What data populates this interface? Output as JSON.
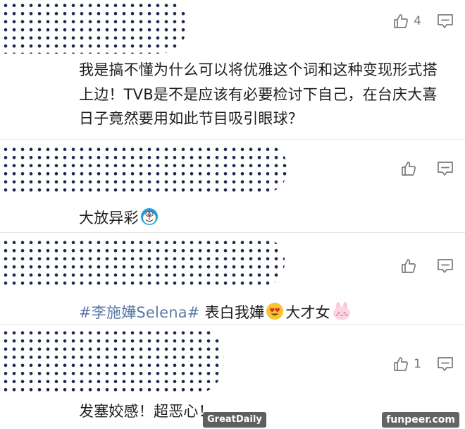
{
  "comments": [
    {
      "like_count": "4",
      "text": "我是搞不懂为什么可以将优雅这个词和这种变现形式搭上边！TVB是不是应该有必要检讨下自己，在台庆大喜日子竟然要用如此节目吸引眼球？"
    },
    {
      "like_count": "",
      "text": "大放异彩",
      "emoji_name": "doraemon-face-icon"
    },
    {
      "like_count": "",
      "topic": "#李施嬅Selena#",
      "text": " 表白我嬅",
      "emoji_1": "heart-eyes-emoji",
      "text_2": "大才女",
      "emoji_2": "pink-bunny-emoji"
    },
    {
      "like_count": "1",
      "text": "发塞姣感！超恶心！"
    }
  ],
  "watermarks": {
    "left": "GreatDaily",
    "right": "funpeer.com"
  },
  "colors": {
    "topic_link": "#5b7aa8",
    "icon_gray": "#7a7a7a",
    "redaction_dots": "#1c2b4d"
  }
}
